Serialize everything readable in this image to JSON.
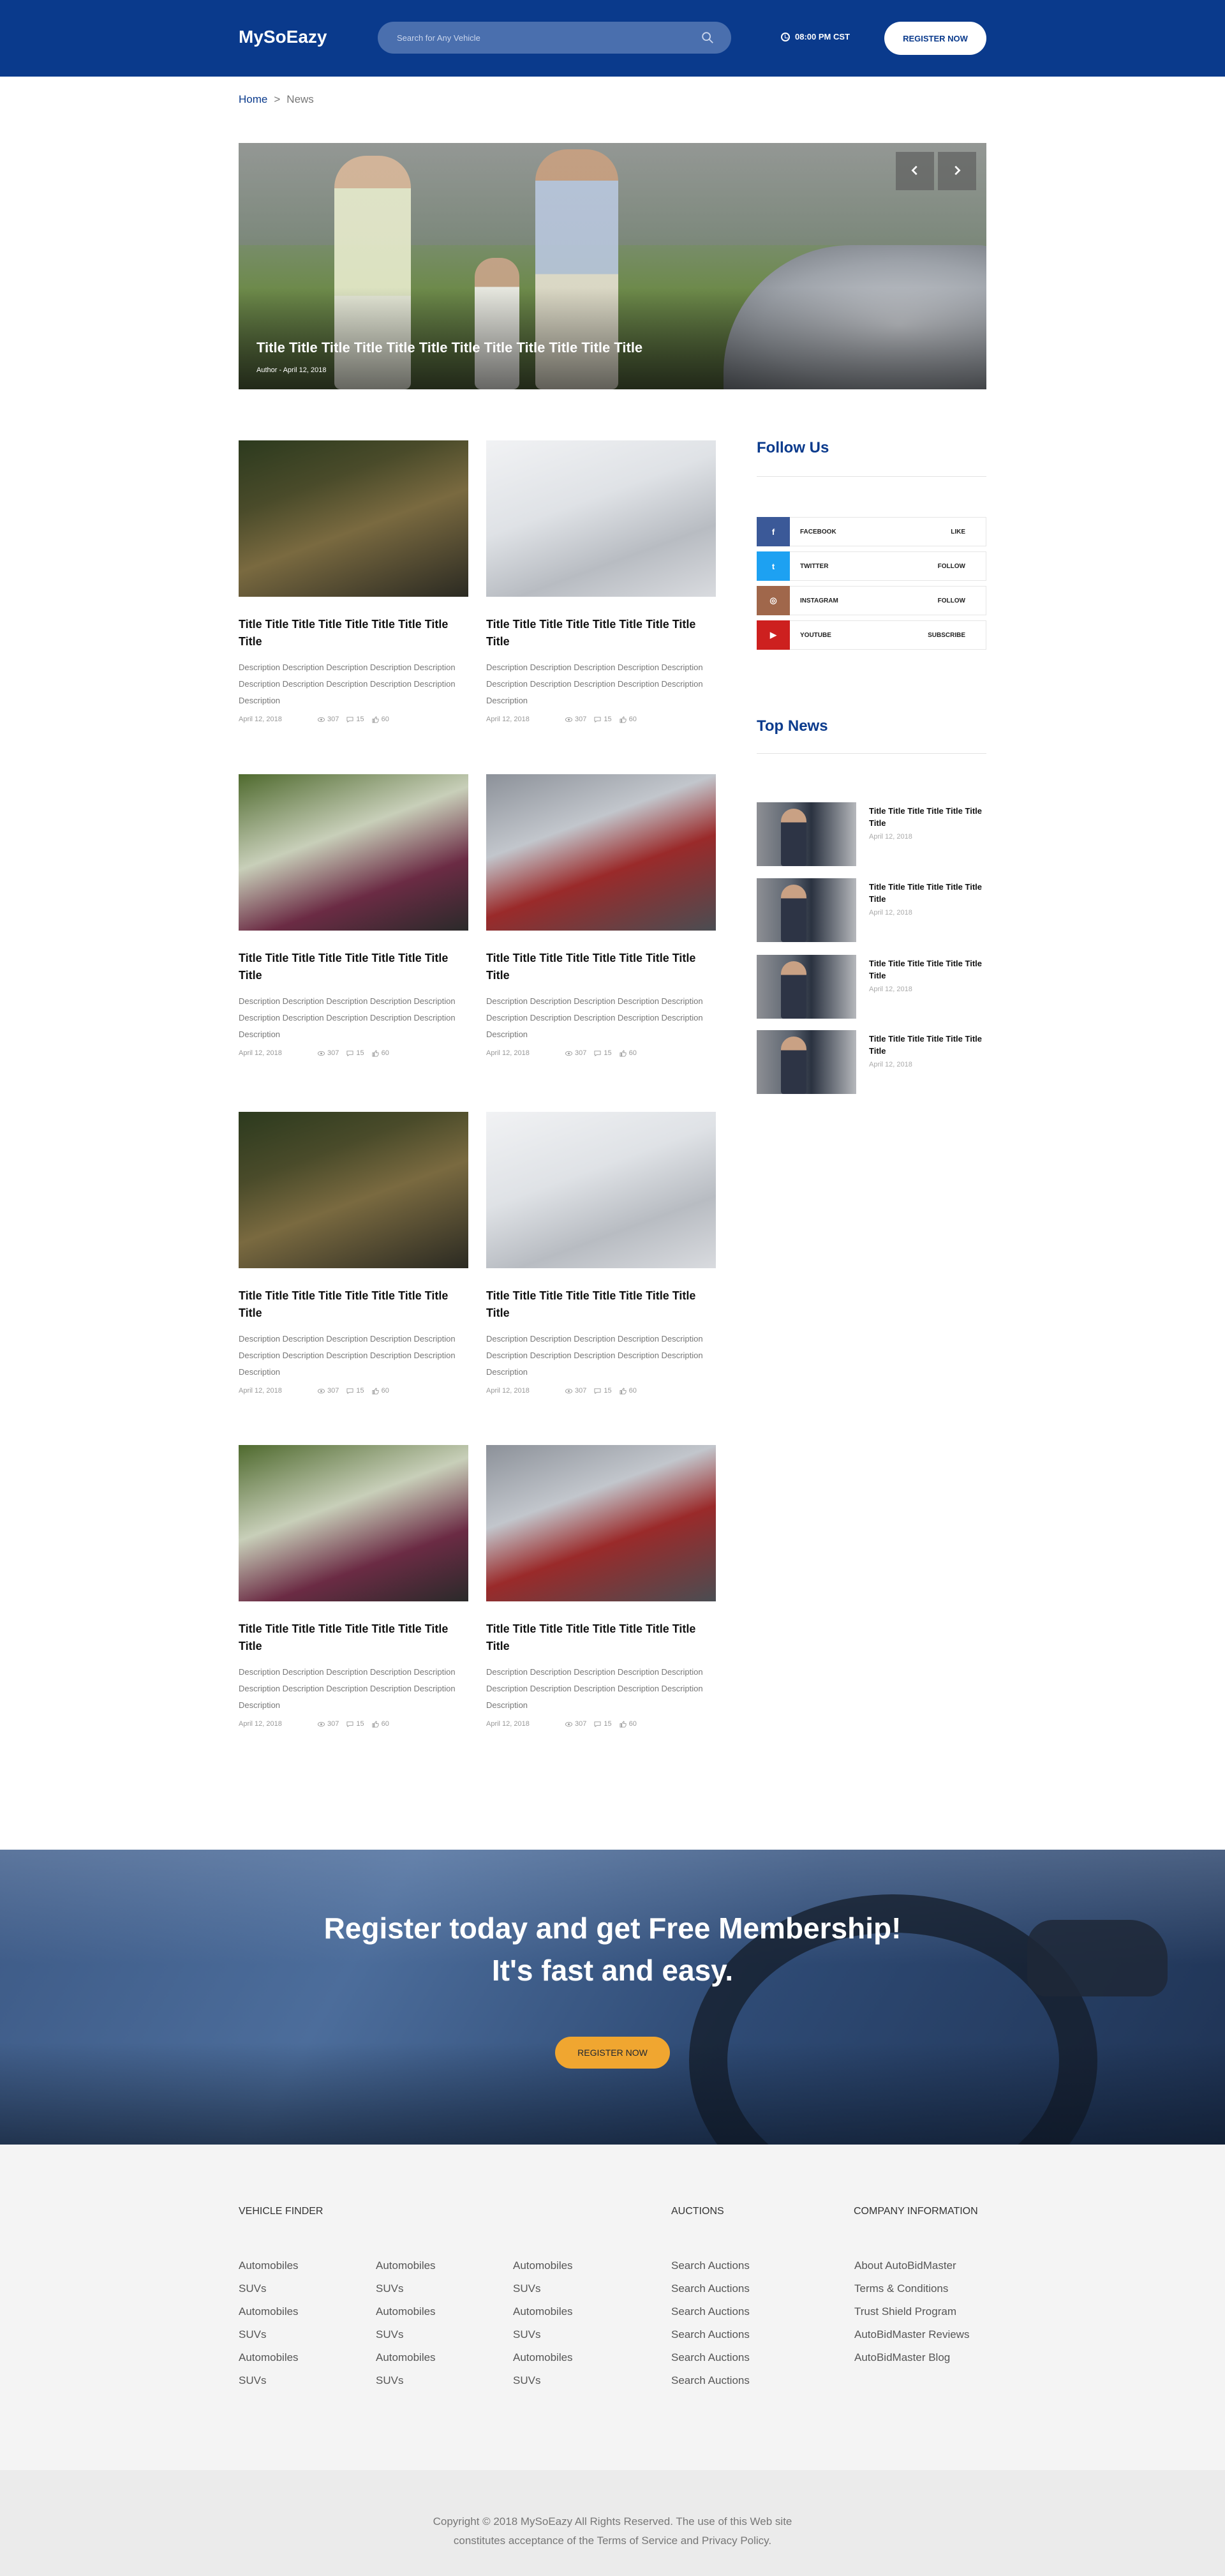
{
  "header": {
    "logo": "MySoEazy",
    "search_placeholder": "Search for Any Vehicle",
    "time": "08:00 PM CST",
    "register_label": "REGISTER NOW"
  },
  "breadcrumb": {
    "home": "Home",
    "separator": ">",
    "current": "News"
  },
  "hero": {
    "title": "Title Title Title Title Title Title Title Title Title Title Title Title",
    "meta": "Author - April 12, 2018"
  },
  "cards": [
    {
      "title": "Title Title Title Title Title Title Title Title Title",
      "desc": "Description Description Description Description Description Description Description Description Description Description Description",
      "date": "April 12, 2018",
      "views": "307",
      "comments": "15",
      "likes": "60"
    },
    {
      "title": "Title Title Title Title Title Title Title Title Title",
      "desc": "Description Description Description Description Description Description Description Description Description Description Description",
      "date": "April 12, 2018",
      "views": "307",
      "comments": "15",
      "likes": "60"
    },
    {
      "title": "Title Title Title Title Title Title Title Title Title",
      "desc": "Description Description Description Description Description Description Description Description Description Description Description",
      "date": "April 12, 2018",
      "views": "307",
      "comments": "15",
      "likes": "60"
    },
    {
      "title": "Title Title Title Title Title Title Title Title Title",
      "desc": "Description Description Description Description Description Description Description Description Description Description Description",
      "date": "April 12, 2018",
      "views": "307",
      "comments": "15",
      "likes": "60"
    },
    {
      "title": "Title Title Title Title Title Title Title Title Title",
      "desc": "Description Description Description Description Description Description Description Description Description Description Description",
      "date": "April 12, 2018",
      "views": "307",
      "comments": "15",
      "likes": "60"
    },
    {
      "title": "Title Title Title Title Title Title Title Title Title",
      "desc": "Description Description Description Description Description Description Description Description Description Description Description",
      "date": "April 12, 2018",
      "views": "307",
      "comments": "15",
      "likes": "60"
    },
    {
      "title": "Title Title Title Title Title Title Title Title Title",
      "desc": "Description Description Description Description Description Description Description Description Description Description Description",
      "date": "April 12, 2018",
      "views": "307",
      "comments": "15",
      "likes": "60"
    },
    {
      "title": "Title Title Title Title Title Title Title Title Title",
      "desc": "Description Description Description Description Description Description Description Description Description Description Description",
      "date": "April 12, 2018",
      "views": "307",
      "comments": "15",
      "likes": "60"
    }
  ],
  "sidebar": {
    "follow_title": "Follow Us",
    "social": [
      {
        "name": "FACEBOOK",
        "action": "LIKE",
        "icon": "facebook-icon",
        "color": "#3b5998",
        "glyph": "f"
      },
      {
        "name": "TWITTER",
        "action": "FOLLOW",
        "icon": "twitter-icon",
        "color": "#1da1f2",
        "glyph": "t"
      },
      {
        "name": "INSTAGRAM",
        "action": "FOLLOW",
        "icon": "instagram-icon",
        "color": "#a0674b",
        "glyph": "◎"
      },
      {
        "name": "YOUTUBE",
        "action": "SUBSCRIBE",
        "icon": "youtube-icon",
        "color": "#cd201f",
        "glyph": "▶"
      }
    ],
    "top_title": "Top News",
    "top_news": [
      {
        "title": "Title Title Title Title Title Title Title",
        "date": "April 12, 2018"
      },
      {
        "title": "Title Title Title Title Title Title Title",
        "date": "April 12, 2018"
      },
      {
        "title": "Title Title Title Title Title Title Title",
        "date": "April 12, 2018"
      },
      {
        "title": "Title Title Title Title Title Title Title",
        "date": "April 12, 2018"
      }
    ]
  },
  "promo": {
    "line1": "Register today and get Free Membership!",
    "line2": "It's fast and easy.",
    "button": "REGISTER NOW"
  },
  "footer": {
    "vehicle_finder": {
      "heading": "VEHICLE FINDER",
      "col1": [
        "Automobiles",
        "SUVs",
        "Automobiles",
        "SUVs",
        "Automobiles",
        "SUVs"
      ],
      "col2": [
        "Automobiles",
        "SUVs",
        "Automobiles",
        "SUVs",
        "Automobiles",
        "SUVs"
      ],
      "col3": [
        "Automobiles",
        "SUVs",
        "Automobiles",
        "SUVs",
        "Automobiles",
        "SUVs"
      ]
    },
    "auctions": {
      "heading": "AUCTIONS",
      "links": [
        "Search Auctions",
        "Search Auctions",
        "Search Auctions",
        "Search Auctions",
        "Search Auctions",
        "Search Auctions"
      ]
    },
    "company": {
      "heading": "COMPANY INFORMATION",
      "links": [
        "About AutoBidMaster",
        "Terms & Conditions",
        "Trust Shield Program",
        "AutoBidMaster Reviews",
        "AutoBidMaster Blog"
      ]
    },
    "copyright_line1": "Copyright © 2018  MySoEazy All Rights Reserved. The use of this Web site",
    "copyright_line2": "constitutes acceptance of the Terms of Service and Privacy Policy."
  }
}
